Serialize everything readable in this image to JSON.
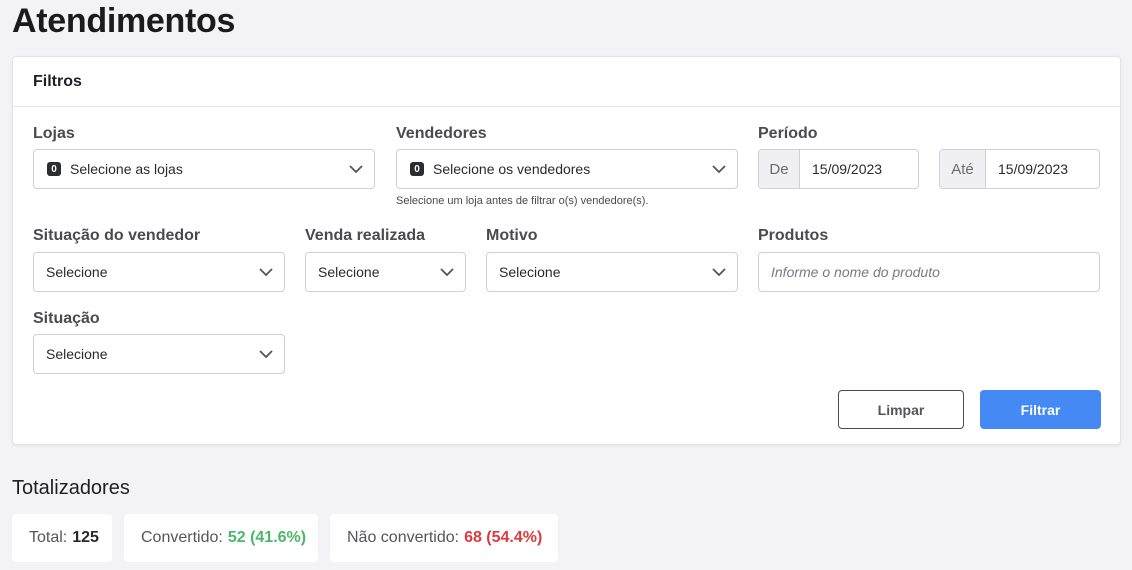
{
  "page": {
    "title": "Atendimentos"
  },
  "filters": {
    "header": "Filtros",
    "lojas": {
      "label": "Lojas",
      "badge": "0",
      "placeholder": "Selecione as lojas"
    },
    "vendedores": {
      "label": "Vendedores",
      "badge": "0",
      "placeholder": "Selecione os vendedores",
      "hint": "Selecione um loja antes de filtrar o(s) vendedore(s)."
    },
    "periodo": {
      "label": "Período",
      "de_label": "De",
      "de_value": "15/09/2023",
      "ate_label": "Até",
      "ate_value": "15/09/2023"
    },
    "situacao_vendedor": {
      "label": "Situação do vendedor",
      "value": "Selecione"
    },
    "venda_realizada": {
      "label": "Venda realizada",
      "value": "Selecione"
    },
    "motivo": {
      "label": "Motivo",
      "value": "Selecione"
    },
    "produtos": {
      "label": "Produtos",
      "placeholder": "Informe o nome do produto"
    },
    "situacao": {
      "label": "Situação",
      "value": "Selecione"
    },
    "buttons": {
      "clear": "Limpar",
      "filter": "Filtrar"
    }
  },
  "totals": {
    "title": "Totalizadores",
    "total": {
      "label": "Total:",
      "value": "125"
    },
    "convertido": {
      "label": "Convertido:",
      "value": "52 (41.6%)"
    },
    "nao_convertido": {
      "label": "Não convertido:",
      "value": "68 (54.4%)"
    }
  },
  "colors": {
    "primary": "#4589f5",
    "success": "#49b86c",
    "danger": "#dc3a3f"
  }
}
